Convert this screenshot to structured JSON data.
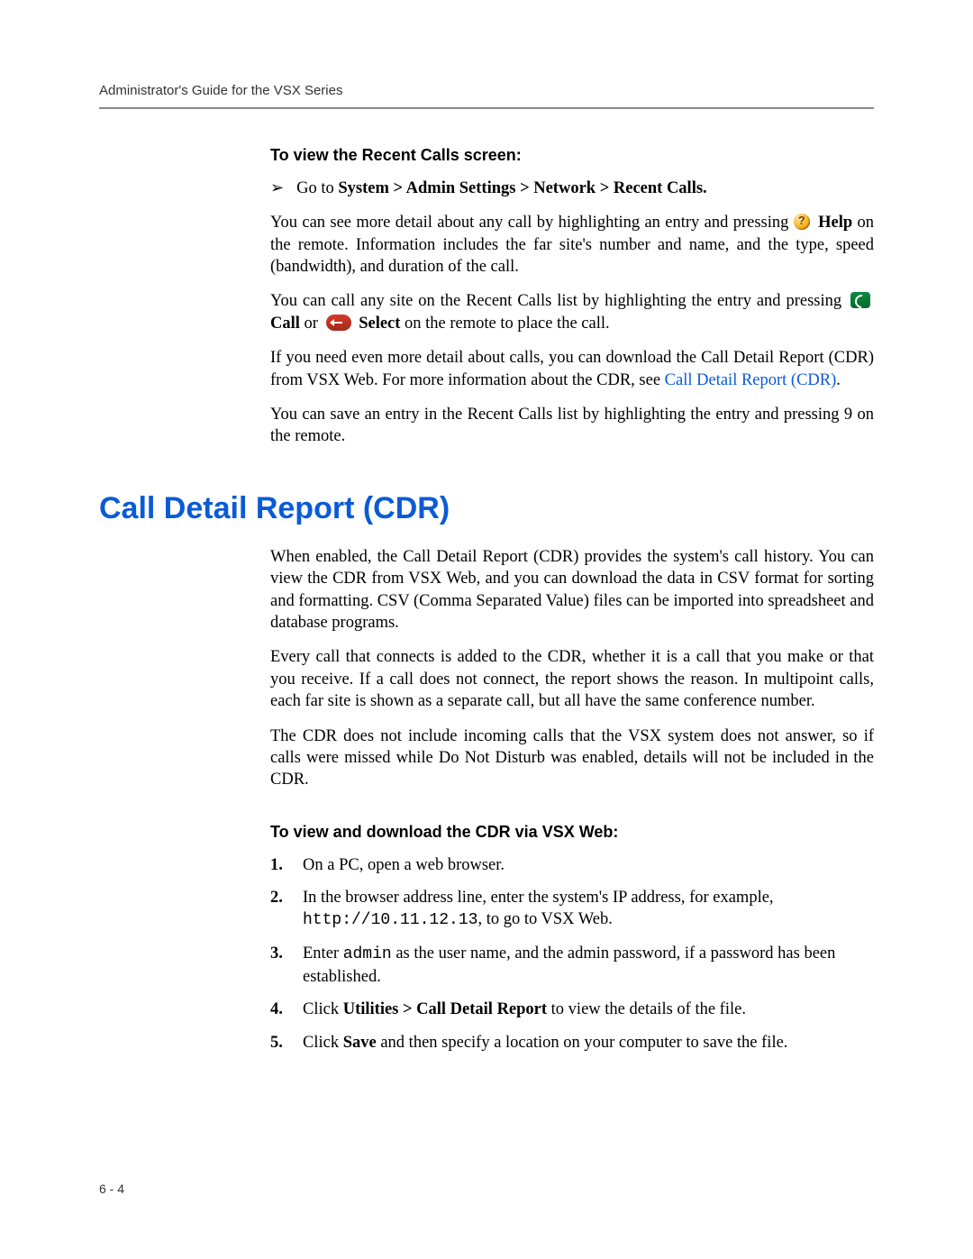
{
  "header": {
    "running_head": "Administrator's Guide for the VSX Series"
  },
  "footer": {
    "page_number": "6 - 4"
  },
  "section1": {
    "subhead": "To view the Recent Calls screen:",
    "bullet": {
      "arrow": "➢",
      "pre": "Go to ",
      "bold_path": "System > Admin Settings > Network > Recent Calls."
    },
    "p1": {
      "t1": "You can see more detail about any call by highlighting an entry and pressing ",
      "help_bold": "Help",
      "t2": " on the remote. Information includes the far site's number and name, and the type, speed (bandwidth), and duration of the call."
    },
    "p2": {
      "t1": "You can call any site on the Recent Calls list by highlighting the entry and pressing ",
      "call_bold": "Call",
      "t2": " or ",
      "select_bold": "Select",
      "t3": " on the remote to place the call."
    },
    "p3": {
      "t1": "If you need even more detail about calls, you can download the Call Detail Report (CDR) from VSX Web. For more information about the CDR, see ",
      "link": "Call Detail Report (CDR)",
      "t2": "."
    },
    "p4": "You can save an entry in the Recent Calls list by highlighting the entry and pressing 9 on the remote."
  },
  "section2": {
    "title": "Call Detail Report (CDR)",
    "p1": "When enabled, the Call Detail Report (CDR) provides the system's call history. You can view the CDR from VSX Web, and you can download the data in CSV format for sorting and formatting. CSV (Comma Separated Value) files can be imported into spreadsheet and database programs.",
    "p2": "Every call that connects is added to the CDR, whether it is a call that you make or that you receive. If a call does not connect, the report shows the reason. In multipoint calls, each far site is shown as a separate call, but all have the same conference number.",
    "p3": "The CDR does not include incoming calls that the VSX system does not answer, so if calls were missed while Do Not Disturb was enabled, details will not be included in the CDR.",
    "subhead": "To view and download the CDR via VSX Web:",
    "steps": [
      {
        "num": "1.",
        "body": {
          "t1": "On a PC, open a web browser."
        }
      },
      {
        "num": "2.",
        "body": {
          "t1": "In the browser address line, enter the system's IP address, for example, ",
          "mono": "http://10.11.12.13",
          "t2": ", to go to VSX Web."
        }
      },
      {
        "num": "3.",
        "body": {
          "t1": "Enter ",
          "mono": "admin",
          "t2": " as the user name, and the admin password, if a password has been established."
        }
      },
      {
        "num": "4.",
        "body": {
          "t1": "Click ",
          "bold": "Utilities > Call Detail Report",
          "t2": " to view the details of the file."
        }
      },
      {
        "num": "5.",
        "body": {
          "t1": "Click ",
          "bold": "Save",
          "t2": " and then specify a location on your computer to save the file."
        }
      }
    ]
  }
}
